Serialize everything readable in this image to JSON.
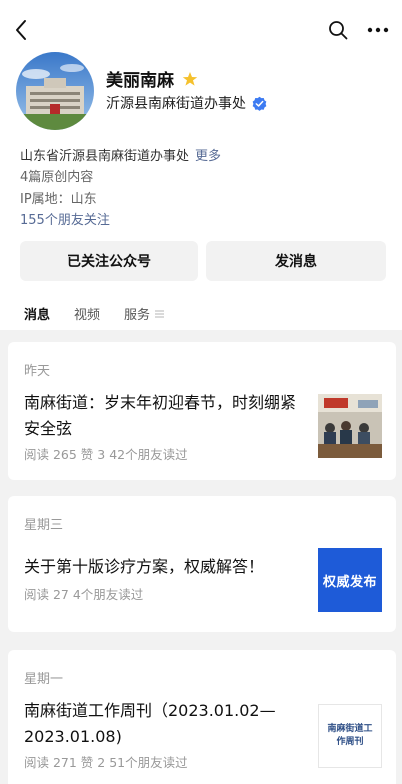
{
  "header": {
    "back_icon": "chevron-left-icon",
    "search_icon": "search-icon",
    "more_icon": "more-dots-icon"
  },
  "profile": {
    "name": "美丽南麻",
    "star_icon": "star-icon",
    "org": "沂源县南麻街道办事处",
    "verify_icon": "verified-check-icon",
    "verify_color": "#3d7bf2",
    "star_color": "#f5c12d"
  },
  "info": {
    "description": "山东省沂源县南麻街道办事处",
    "more_link": "更多",
    "original_count": "4篇原创内容",
    "ip_location": "IP属地：山东",
    "friends_following": "155个朋友关注"
  },
  "actions": {
    "followed": "已关注公众号",
    "message": "发消息"
  },
  "tabs": [
    {
      "label": "消息"
    },
    {
      "label": "视频"
    },
    {
      "label": "服务"
    }
  ],
  "articles": [
    {
      "day": "昨天",
      "title": "南麻街道：岁末年初迎春节，时刻绷紧安全弦",
      "meta": "阅读 265  赞 3  42个朋友读过"
    },
    {
      "day": "星期三",
      "title": "关于第十版诊疗方案，权威解答！",
      "meta": "阅读 27  4个朋友读过",
      "thumb_text": "权威发布",
      "thumb_color": "#1e5bd8"
    },
    {
      "day": "星期一",
      "title": "南麻街道工作周刊（2023.01.02—2023.01.08)",
      "meta": "阅读 271  赞 2  51个朋友读过",
      "thumb_text": "南麻街道工作周刊"
    }
  ]
}
